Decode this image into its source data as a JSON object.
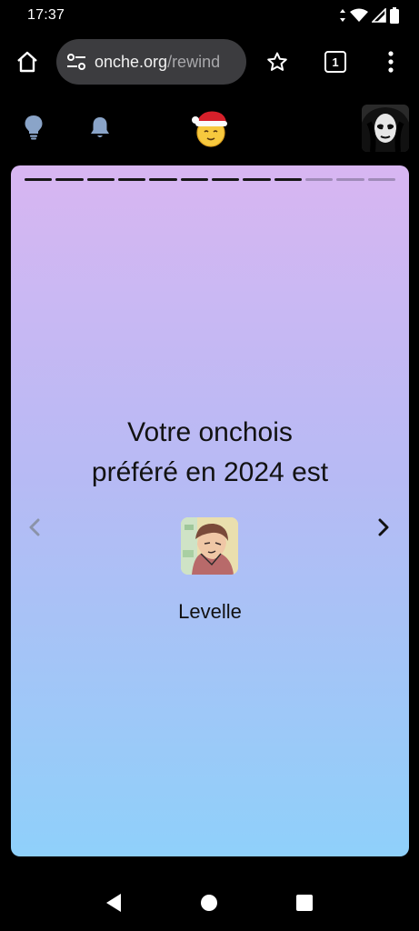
{
  "status_bar": {
    "time": "17:37",
    "icons": [
      "data-arrows-icon",
      "wifi-icon",
      "signal-icon",
      "battery-icon"
    ]
  },
  "browser": {
    "url_host": "onche.org",
    "url_path": "/rewind",
    "tab_count": "1",
    "icons": [
      "home-icon",
      "site-settings-icon",
      "bookmark-star-icon",
      "tabs-icon",
      "overflow-menu-icon"
    ]
  },
  "site_nav": {
    "icons": [
      "lightbulb-icon",
      "bell-icon",
      "santa-hat-logo-icon",
      "user-avatar"
    ]
  },
  "story": {
    "title_line1": "Votre onchois",
    "title_line2": "préféré en 2024 est",
    "favorite_name": "Levelle",
    "segments_total": 12,
    "segments_viewed": 9
  },
  "colors": {
    "card_gradient_top": "#d8b6f2",
    "card_gradient_bottom": "#8fd0fa",
    "url_bar_bg": "#3c3c3f",
    "nav_icon_blue": "#8aa4c8"
  }
}
